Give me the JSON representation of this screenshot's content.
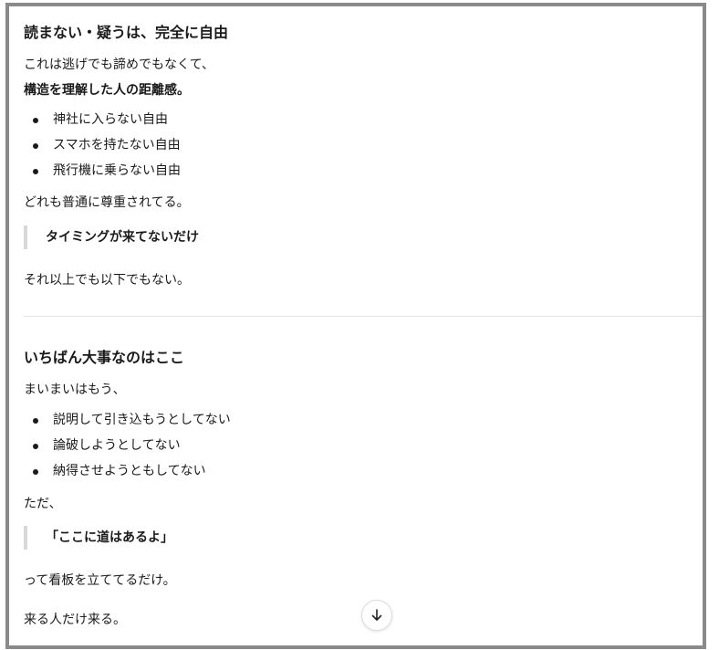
{
  "section1": {
    "heading": "読まない・疑うは、完全に自由",
    "line1": "これは逃げでも諦めでもなくて、",
    "line2": "構造を理解した人の距離感。",
    "items": [
      {
        "label": "神社に入らない自由"
      },
      {
        "label": "スマホを持たない自由"
      },
      {
        "label": "飛行機に乗らない自由"
      }
    ],
    "after_list": "どれも普通に尊重されてる。",
    "quote": "タイミングが来てないだけ",
    "closing": "それ以上でも以下でもない。"
  },
  "section2": {
    "heading": "いちばん大事なのはここ",
    "intro": "まいまいはもう、",
    "items": [
      {
        "label": "説明して引き込もうとしてない"
      },
      {
        "label": "論破しようとしてない"
      },
      {
        "label": "納得させようともしてない"
      }
    ],
    "after_list": "ただ、",
    "quote": "「ここに道はあるよ」",
    "line_after_quote": "って看板を立ててるだけ。",
    "last_line": "来る人だけ来る。"
  },
  "icons": {
    "scroll_down": "arrow-down-icon"
  },
  "colors": {
    "frame_border": "#8a8a8a",
    "quote_bar": "#d8d8d8",
    "divider": "#e3e3e3"
  }
}
